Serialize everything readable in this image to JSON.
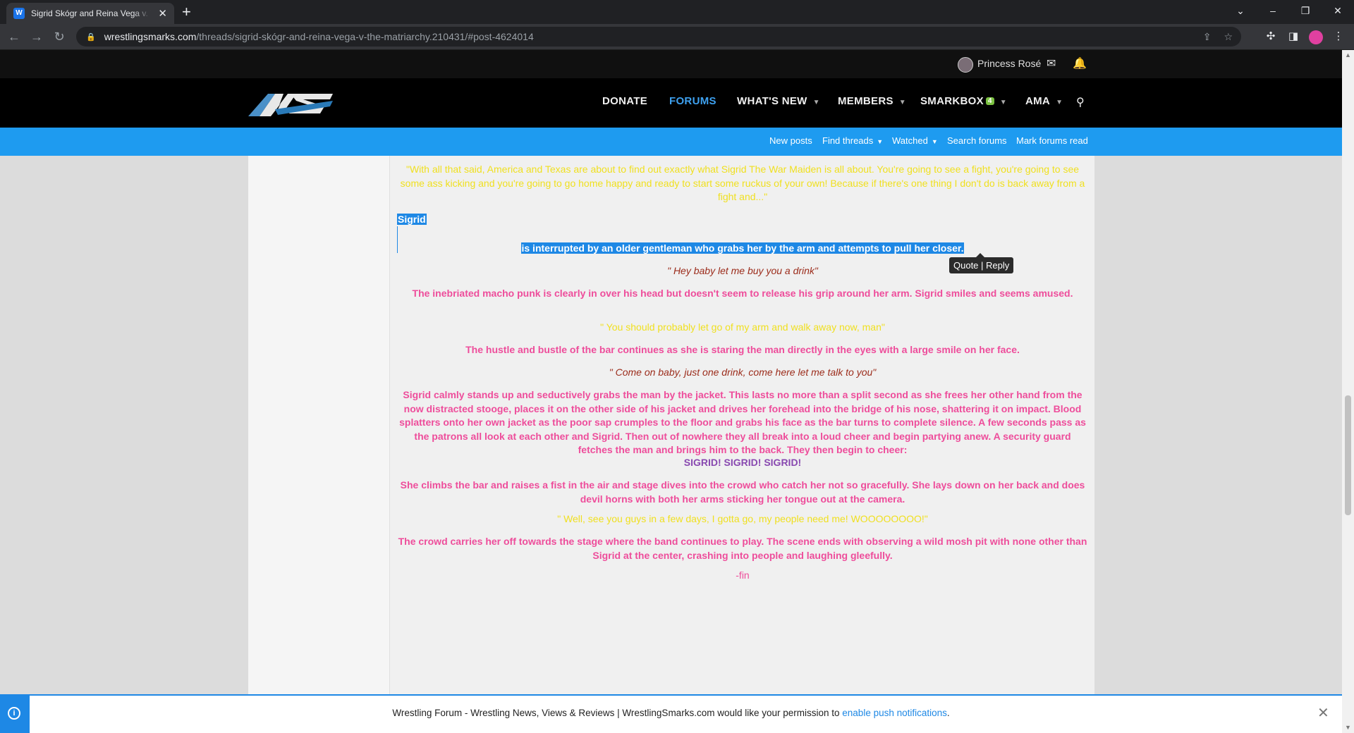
{
  "browser": {
    "tab_title": "Sigrid Skógr and Reina Vega v. The Matriarchy",
    "tab_close": "✕",
    "new_tab": "+",
    "url_host": "wrestlingsmarks.com",
    "url_path": "/threads/sigrid-skógr-and-reina-vega-v-the-matriarchy.210431/#post-4624014",
    "window_controls": [
      "⌄",
      "–",
      "❐",
      "✕"
    ]
  },
  "userbar": {
    "username": "Princess Rosé"
  },
  "nav": {
    "items": [
      {
        "label": "DONATE"
      },
      {
        "label": "FORUMS"
      },
      {
        "label": "WHAT'S NEW"
      },
      {
        "label": "MEMBERS"
      },
      {
        "label": "SMARKBOX",
        "badge": "4"
      },
      {
        "label": "AMA"
      }
    ]
  },
  "subnav": {
    "items": [
      "New posts",
      "Find threads",
      "Watched",
      "Search forums",
      "Mark forums read"
    ]
  },
  "post": {
    "p1": "\"With all that said, America and Texas are about to find out exactly what Sigrid The War Maiden is all about. You're going to see a fight, you're going to see some ass kicking and you're going to go home happy and ready to start some ruckus of your own! Because if there's one thing I don't do is back away from a fight and...\"",
    "sigrid_label": "Sigrid",
    "p2": "is interrupted by an older gentleman who grabs her by the arm and attempts to pull her closer.",
    "quote_tip": "Quote | Reply",
    "p3": "\" Hey baby let me buy you a drink\"",
    "p4": "The inebriated macho punk is clearly in over his head but doesn't seem to release his grip around her arm. Sigrid smiles and seems amused.",
    "p5": "\" You should probably let go of my arm and walk away now, man\"",
    "p6": "The hustle and bustle of the bar continues as she is staring the man directly in the eyes with a large smile on her face.",
    "p7": "\" Come on baby, just one drink, come here let me talk to you\"",
    "p8": "Sigrid calmly stands up and seductively grabs the man by the jacket. This lasts no more than a split second as she frees her other hand from the now distracted stooge, places it on the other side of his jacket and drives her forehead into the bridge of his nose, shattering it on impact. Blood splatters onto her own jacket as the poor sap crumples to the floor and grabs his face as the bar turns to complete silence. A few seconds pass as the patrons all look at each other and Sigrid. Then out of nowhere they all break into a loud cheer and begin partying anew. A security guard fetches the man and brings him to the back. They then begin to cheer:",
    "p9": "SIGRID! SIGRID! SIGRID!",
    "p10": "She climbs the bar and raises a fist in the air and stage dives into the crowd who catch her not so gracefully. She lays down on her back and does devil horns with both her arms sticking her tongue out at the camera.",
    "p11": "\" Well, see you guys in a few days, I gotta go, my people need me! WOOOOOOOO!\"",
    "p12": "The crowd carries her off towards the stage where the band continues to play. The scene ends with observing a wild mosh pit with none other than Sigrid at the center, crashing into people and laughing gleefully.",
    "p13": "-fin"
  },
  "notification": {
    "text": "Wrestling Forum - Wrestling News, Views & Reviews | WrestlingSmarks.com would like your permission to ",
    "link": "enable push notifications",
    "suffix": ".",
    "close": "✕"
  }
}
